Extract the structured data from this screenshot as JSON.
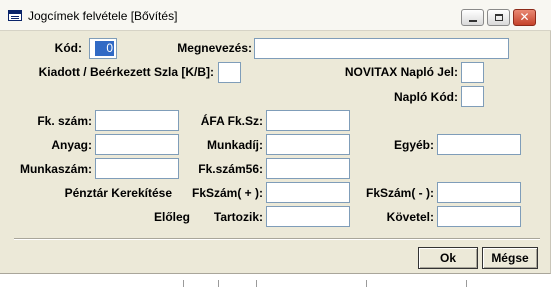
{
  "window": {
    "title": "Jogcímek felvétele [Bővítés]"
  },
  "titlebar_buttons": {
    "minimize_icon": "minimize-icon",
    "maximize_icon": "maximize-icon",
    "close_icon": "close-icon",
    "close_glyph": "✕"
  },
  "form": {
    "kod": {
      "label": "Kód:",
      "value": "0"
    },
    "megnevezes": {
      "label": "Megnevezés:",
      "value": ""
    },
    "kiadott_beerkezett": {
      "label": "Kiadott / Beérkezett Szla [K/B]:",
      "value": ""
    },
    "novitax_naplo_jel": {
      "label": "NOVITAX Napló Jel:",
      "value": ""
    },
    "naplo_kod": {
      "label": "Napló Kód:",
      "value": ""
    },
    "fk_szam": {
      "label": "Fk. szám:",
      "value": ""
    },
    "afa_fk_sz": {
      "label": "ÁFA Fk.Sz:",
      "value": ""
    },
    "anyag": {
      "label": "Anyag:",
      "value": ""
    },
    "munkadij": {
      "label": "Munkadíj:",
      "value": ""
    },
    "egyeb": {
      "label": "Egyéb:",
      "value": ""
    },
    "munkaszam": {
      "label": "Munkaszám:",
      "value": ""
    },
    "fk_szam56": {
      "label": "Fk.szám56:",
      "value": ""
    },
    "penztar_kerekitese": {
      "label": "Pénztár Kerekítése"
    },
    "fkszam_plus": {
      "label": "FkSzám( + ):",
      "value": ""
    },
    "fkszam_minus": {
      "label": "FkSzám( - ):",
      "value": ""
    },
    "eloleg": {
      "label": "Előleg"
    },
    "tartozik": {
      "label": "Tartozik:",
      "value": ""
    },
    "kovetel": {
      "label": "Követel:",
      "value": ""
    }
  },
  "buttons": {
    "ok": "Ok",
    "megse": "Mégse"
  }
}
